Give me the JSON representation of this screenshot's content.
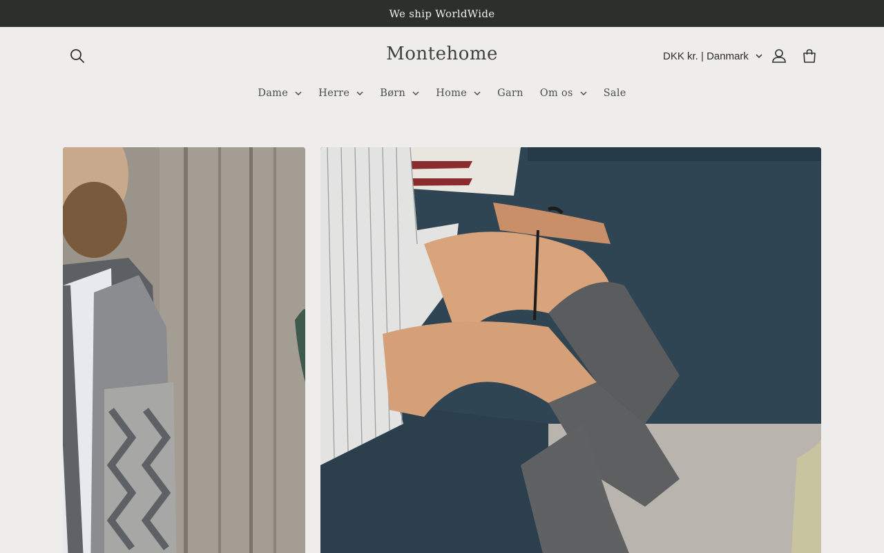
{
  "announcement": {
    "text": "We ship WorldWide"
  },
  "header": {
    "logo": "Montehome",
    "currency": "DKK kr. | Danmark",
    "icons": {
      "search": "search-icon",
      "account": "user-icon",
      "cart": "bag-icon"
    }
  },
  "nav": {
    "items": [
      {
        "label": "Dame",
        "dropdown": true
      },
      {
        "label": "Herre",
        "dropdown": true
      },
      {
        "label": "Børn",
        "dropdown": true
      },
      {
        "label": "Home",
        "dropdown": true
      },
      {
        "label": "Garn",
        "dropdown": false
      },
      {
        "label": "Om os",
        "dropdown": true
      },
      {
        "label": "Sale",
        "dropdown": false
      }
    ]
  },
  "hero": {
    "left_image": "man-in-knitted-cardigan",
    "right_image": "woman-wearing-knit-knee-socks-on-sofa"
  },
  "colors": {
    "announcement_bg": "#2b302d",
    "page_bg": "#efedeb",
    "text": "#2b2f2c"
  }
}
